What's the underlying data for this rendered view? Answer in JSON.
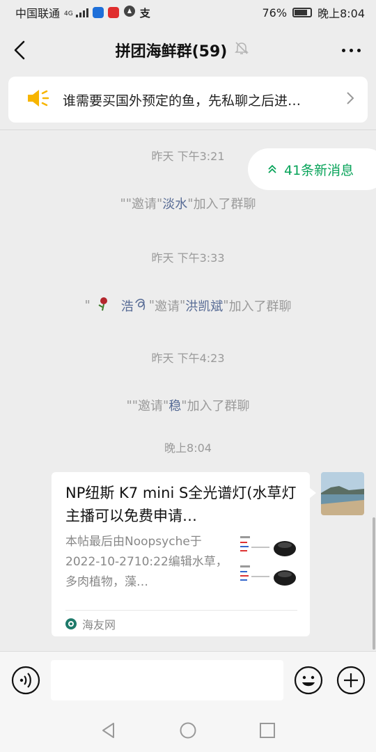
{
  "status_bar": {
    "carrier": "中国联通",
    "network": "4G",
    "battery": "76%",
    "time": "晚上8:04",
    "icons": [
      "signal-icon",
      "shield-app-icon",
      "red-app-icon",
      "compass-icon",
      "alipay-icon",
      "battery-icon"
    ]
  },
  "header": {
    "title": "拼团海鲜群(59)",
    "icons": [
      "back-icon",
      "mute-bell-icon",
      "more-icon"
    ]
  },
  "notice": {
    "text": "谁需要买国外预定的鱼，先私聊之后进…",
    "icon": "speaker-icon"
  },
  "new_messages": {
    "label": "41条新消息",
    "icon": "double-chevron-up-icon"
  },
  "messages": [
    {
      "type": "time",
      "text": "昨天 下午3:21"
    },
    {
      "type": "system",
      "q1": "\"\"",
      "verb": "邀请",
      "q2": "\"",
      "name": "淡水",
      "q3": "\"",
      "suffix": "加入了群聊"
    },
    {
      "type": "time",
      "text": "昨天 下午3:33"
    },
    {
      "type": "system",
      "q1": "\"",
      "inviter": "浩",
      "q1b": "\"",
      "verb": "邀请",
      "q2": "\"",
      "name": "洪凯斌",
      "q3": "\"",
      "suffix": "加入了群聊"
    },
    {
      "type": "time",
      "text": "昨天 下午4:23"
    },
    {
      "type": "system",
      "q1": "\"\"",
      "verb": "邀请",
      "q2": "\"",
      "name": "稳",
      "q3": "\"",
      "suffix": "加入了群聊"
    },
    {
      "type": "time",
      "text": "晚上8:04"
    }
  ],
  "link_card": {
    "title": "NP纽斯 K7 mini S全光谱灯(水草灯主播可以免费申请…",
    "description": "本帖最后由Noopsyche于2022-10-2710:22编辑水草，多肉植物，藻…",
    "source": "海友网",
    "thumbnail_icon": "lamp-product-thumbnail"
  },
  "colors": {
    "background": "#ededed",
    "accent_green": "#07a359",
    "name_link": "#576b95",
    "muted_text": "#9a9a9a",
    "speaker": "#f7b500"
  },
  "input_bar": {
    "icons": [
      "voice-icon",
      "emoji-icon",
      "plus-icon"
    ],
    "value": ""
  },
  "nav_bar": {
    "icons": [
      "nav-back-icon",
      "nav-home-icon",
      "nav-recents-icon"
    ]
  }
}
